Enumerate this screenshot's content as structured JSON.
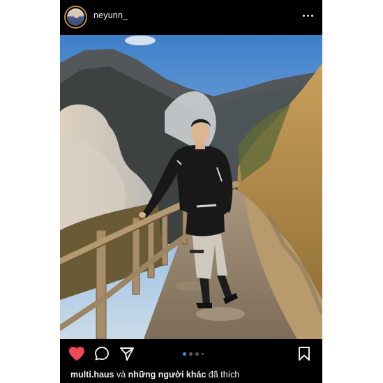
{
  "post": {
    "username": "neyunn_",
    "liked_by_user": "multi.haus",
    "liked_by_connector": " và ",
    "liked_by_others": "những người khác",
    "liked_by_suffix": " đã thích",
    "carousel": {
      "count": 4,
      "active_index": 0
    },
    "liked": true
  },
  "icons": {
    "more": "more-horizontal-icon",
    "like": "heart-icon",
    "comment": "comment-bubble-icon",
    "share": "paper-plane-icon",
    "save": "bookmark-icon"
  },
  "colors": {
    "background": "#000000",
    "like_red": "#ed4956",
    "carousel_active": "#3d8ee8",
    "text": "#f0f0f0"
  }
}
